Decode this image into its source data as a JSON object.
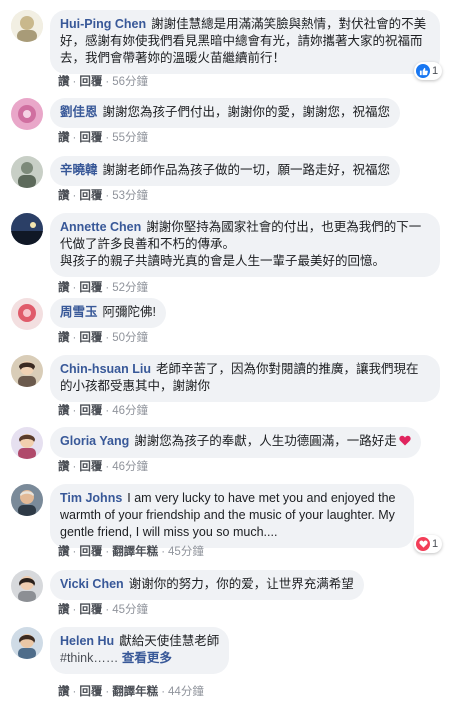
{
  "comments": [
    {
      "name": "Hui-Ping Chen",
      "text": "謝謝佳慧總是用滿滿笑臉與熱情，對伏社會的不美好，感謝有妳使我們看見黑暗中總會有光，請妳攜著大家的祝福而去，我們會帶著妳的溫暖火苗繼續前行！",
      "actions": [
        "讚",
        "回覆"
      ],
      "time": "56分鐘",
      "reaction_count": "1",
      "reaction_icon": "like-icon"
    },
    {
      "name": "劉佳恩",
      "text": "謝謝您為孩子們付出，謝謝你的愛，謝謝您，祝福您",
      "actions": [
        "讚",
        "回覆"
      ],
      "time": "55分鐘"
    },
    {
      "name": "辛曉韓",
      "text": "謝謝老師作品為孩子做的一切，願一路走好，祝福您",
      "actions": [
        "讚",
        "回覆"
      ],
      "time": "53分鐘"
    },
    {
      "name": "Annette Chen",
      "text": "謝謝你堅持為國家社會的付出，也更為我們的下一代做了許多良善和不朽的傳承。",
      "text2": "與孩子的親子共讀時光真的會是人生一輩子最美好的回憶。",
      "actions": [
        "讚",
        "回覆"
      ],
      "time": "52分鐘"
    },
    {
      "name": "周雪玉",
      "text": "阿彌陀佛!",
      "actions": [
        "讚",
        "回覆"
      ],
      "time": "50分鐘"
    },
    {
      "name": "Chin-hsuan Liu",
      "text": "老師辛苦了，因為你對閱讀的推廣，讓我們現在的小孩都受惠其中，謝謝你",
      "actions": [
        "讚",
        "回覆"
      ],
      "time": "46分鐘"
    },
    {
      "name": "Gloria Yang",
      "text": "謝謝您為孩子的奉獻，人生功德圓滿，一路好走",
      "actions": [
        "讚",
        "回覆"
      ],
      "time": "46分鐘",
      "heart_color": "#e0245e"
    },
    {
      "name": "Tim Johns",
      "text": "I am very lucky to have met you and enjoyed the warmth of your friendship and the music of your laughter. My gentle friend, I will miss you so much....",
      "actions": [
        "讚",
        "回覆",
        "翻譯年糕"
      ],
      "time": "45分鐘",
      "reaction_count": "1",
      "reaction_icon": "love-icon"
    },
    {
      "name": "Vicki Chen",
      "text": "谢谢你的努力，你的爱，让世界充满希望",
      "actions": [
        "讚",
        "回覆"
      ],
      "time": "45分鐘"
    },
    {
      "name": "Helen Hu",
      "text": "獻給天使佳慧老師",
      "text2": "#think……",
      "see_more": "查看更多",
      "actions": [
        "讚",
        "回覆",
        "翻譯年糕"
      ],
      "time": "44分鐘"
    }
  ],
  "colors": {
    "name": "#385898",
    "bubble_bg": "#f0f2f5",
    "like_blue": "#1877f2",
    "love_red": "#f33e58"
  }
}
